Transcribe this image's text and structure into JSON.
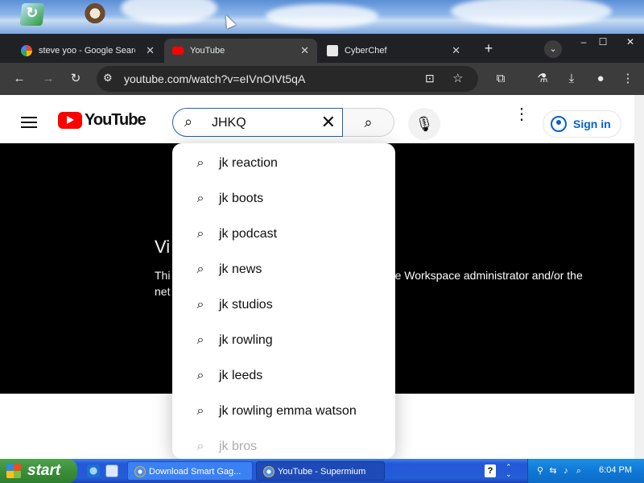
{
  "browser": {
    "tabs": [
      {
        "title": "steve yoo - Google Search",
        "favicon": "google-icon"
      },
      {
        "title": "YouTube",
        "favicon": "youtube-icon",
        "active": true
      },
      {
        "title": "CyberChef",
        "favicon": "cyberchef-icon"
      }
    ],
    "url": "youtube.com/watch?v=eIVnOIVt5qA"
  },
  "youtube": {
    "logo_text": "YouTube",
    "search_value": "JHKQ",
    "signin_label": "Sign in",
    "suggestions": [
      "jk reaction",
      "jk boots",
      "jk podcast",
      "jk news",
      "jk studios",
      "jk rowling",
      "jk leeds",
      "jk rowling emma watson",
      "jk bros"
    ],
    "player": {
      "heading": "Vi",
      "message_line1_start": "Thi",
      "message_line1_end": "le Workspace administrator and/or the",
      "message_line2_start": "net"
    }
  },
  "taskbar": {
    "start_label": "start",
    "tasks": [
      {
        "title": "Download Smart Gag..."
      },
      {
        "title": "YouTube - Supermium",
        "active": true
      }
    ],
    "clock": "6:04 PM"
  },
  "colors": {
    "youtube_red": "#ff0000",
    "link_blue": "#065fd4",
    "xp_blue": "#245dd8",
    "xp_green": "#3a8f3a"
  }
}
